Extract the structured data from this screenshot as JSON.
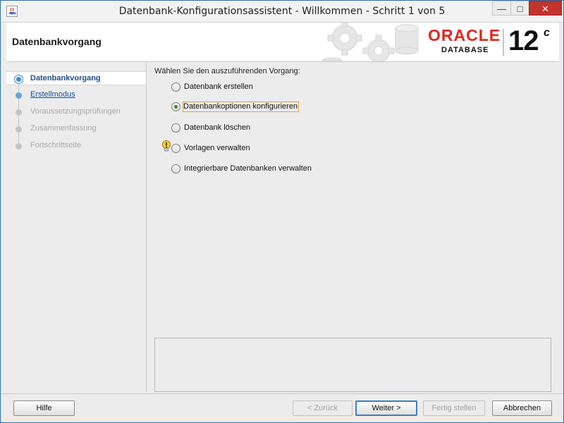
{
  "window": {
    "title": "Datenbank-Konfigurationsassistent - Willkommen - Schritt 1 von 5",
    "controls": {
      "minimize": "—",
      "maximize": "□",
      "close": "✕"
    }
  },
  "banner": {
    "title": "Datenbankvorgang",
    "brand": "ORACLE",
    "product": "DATABASE",
    "version": "12",
    "version_suffix": "c"
  },
  "nav": {
    "items": [
      {
        "label": "Datenbankvorgang",
        "state": "active"
      },
      {
        "label": "Erstellmodus",
        "state": "link"
      },
      {
        "label": "Voraussetzungsprüfungen",
        "state": "disabled"
      },
      {
        "label": "Zusammenfassung",
        "state": "disabled"
      },
      {
        "label": "Fortschrittseite",
        "state": "disabled"
      }
    ]
  },
  "content": {
    "prompt": "Wählen Sie den auszuführenden Vorgang:",
    "options": [
      {
        "label": "Datenbank erstellen",
        "checked": false
      },
      {
        "label": "Datenbankoptionen konfigurieren",
        "checked": true
      },
      {
        "label": "Datenbank löschen",
        "checked": false
      },
      {
        "label": "Vorlagen verwalten",
        "checked": false
      },
      {
        "label": "Integrierbare Datenbanken verwalten",
        "checked": false
      }
    ]
  },
  "footer": {
    "help": "Hilfe",
    "back": "< Zurück",
    "next": "Weiter >",
    "finish": "Fertig stellen",
    "cancel": "Abbrechen"
  },
  "colors": {
    "oracle_red": "#e0281d",
    "nav_active": "#1f4e8c",
    "link_blue": "#1f4e9a",
    "close_red": "#c7312e",
    "radio_checked": "#2f8a2f"
  },
  "icons": [
    "java-app-icon",
    "gears-database-graphic",
    "hint-bulb-icon"
  ]
}
